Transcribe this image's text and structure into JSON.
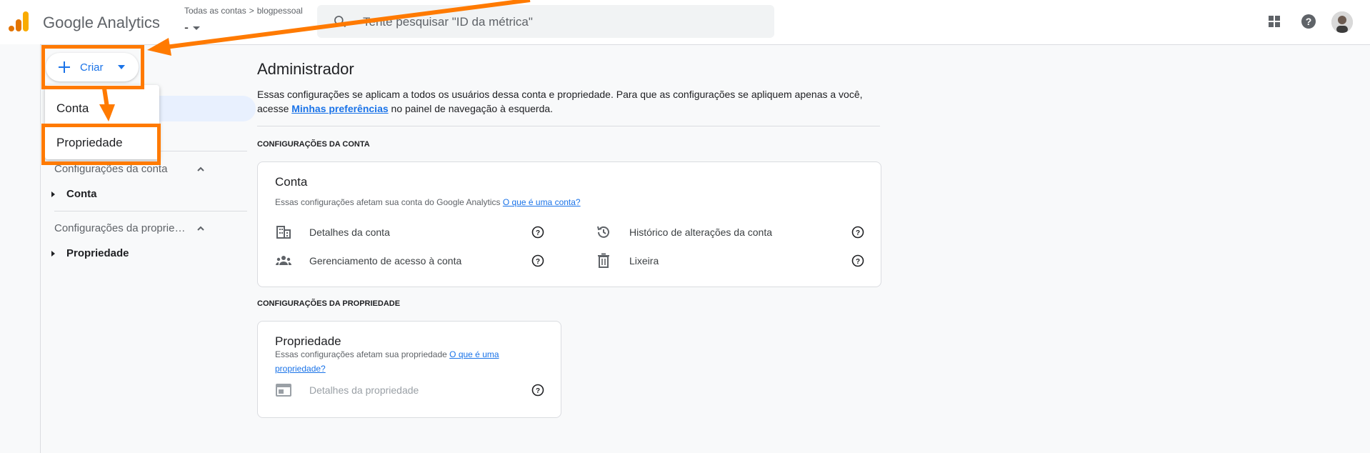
{
  "header": {
    "app_name": "Google Analytics",
    "breadcrumb": [
      "Todas as contas",
      "blogpessoal"
    ],
    "current_account": "-",
    "search_placeholder": "Tente pesquisar \"ID da métrica\""
  },
  "create_button": {
    "label": "Criar"
  },
  "create_menu": {
    "items": [
      "Conta",
      "Propriedade"
    ]
  },
  "nav": {
    "account_section": "Configurações da conta",
    "account_item": "Conta",
    "property_section": "Configurações da propriedade",
    "property_item": "Propriedade"
  },
  "main": {
    "title": "Administrador",
    "intro_text": "Essas configurações se aplicam a todos os usuários dessa conta e propriedade. Para que as configurações se apliquem apenas a você, acesse ",
    "intro_link": "Minhas preferências",
    "intro_suffix": " no painel de navegação à esquerda.",
    "account_heading": "CONFIGURAÇÕES DA CONTA",
    "account_card": {
      "title": "Conta",
      "desc": "Essas configurações afetam sua conta do Google Analytics ",
      "desc_link": "O que é uma conta?",
      "items": [
        "Detalhes da conta",
        "Histórico de alterações da conta",
        "Gerenciamento de acesso à conta",
        "Lixeira"
      ]
    },
    "property_heading": "CONFIGURAÇÕES DA PROPRIEDADE",
    "property_card": {
      "title": "Propriedade",
      "desc": "Essas configurações afetam sua propriedade ",
      "desc_link": "O que é uma propriedade?",
      "items": [
        "Detalhes da propriedade"
      ]
    }
  },
  "colors": {
    "accent": "#1a73e8",
    "annotation": "#ff7a00",
    "logo_dark": "#e37400",
    "logo_light": "#f9ab00"
  }
}
